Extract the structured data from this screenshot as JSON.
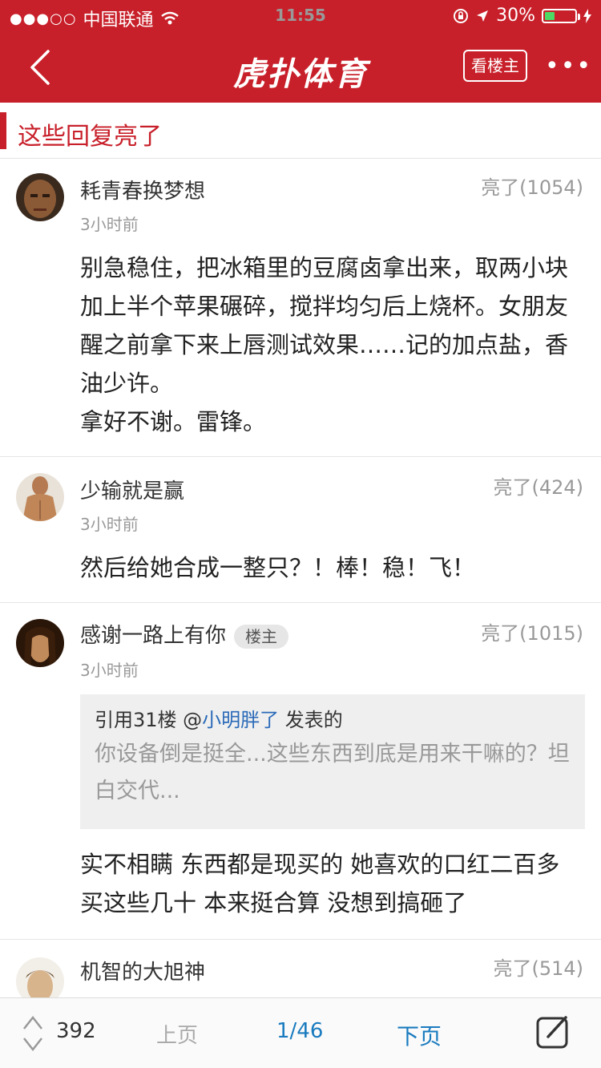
{
  "status_bar": {
    "signal": "●●●○○",
    "carrier": "中国联通",
    "time": "11:55",
    "battery": "30%"
  },
  "header": {
    "logo": "虎扑体育",
    "op_only_label": "看楼主",
    "more_label": "•••"
  },
  "section": {
    "title": "这些回复亮了"
  },
  "comments": [
    {
      "user": "耗青春换梦想",
      "likes": "亮了(1054)",
      "time": "3小时前",
      "text": "别急稳住，把冰箱里的豆腐卤拿出来，取两小块加上半个苹果碾碎，搅拌均匀后上烧杯。女朋友醒之前拿下来上唇测试效果……记的加点盐，香油少许。\n拿好不谢。雷锋。"
    },
    {
      "user": "少输就是赢",
      "likes": "亮了(424)",
      "time": "3小时前",
      "text": "然后给她合成一整只？！棒！稳！飞！"
    },
    {
      "user": "感谢一路上有你",
      "badge": "楼主",
      "likes": "亮了(1015)",
      "time": "3小时前",
      "quote": {
        "prefix": "引用31楼 @",
        "mention": "小明胖了",
        "suffix": " 发表的",
        "text": "你设备倒是挺全...这些东西到底是用来干嘛的？坦白交代..."
      },
      "text": "实不相瞒 东西都是现买的 她喜欢的口红二百多 买这些几十 本来挺合算 没想到搞砸了"
    },
    {
      "user": "机智的大旭神",
      "likes": "亮了(514)"
    }
  ],
  "footer": {
    "vote_count": "392",
    "prev_label": "上页",
    "page_indicator": "1/46",
    "next_label": "下页"
  },
  "colors": {
    "brand_red": "#c8202a",
    "link_blue": "#1a7bbf",
    "muted_gray": "#999999"
  }
}
